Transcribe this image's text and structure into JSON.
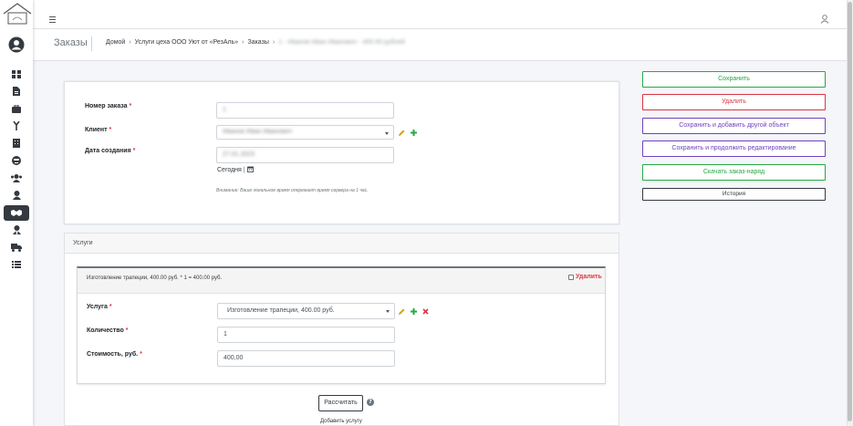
{
  "topbar": {
    "menu_icon": "hamburger-icon",
    "user_icon": "user-icon"
  },
  "sidebar": {
    "logo_icon": "house-logo-icon",
    "avatar_icon": "user-circle-icon",
    "items": [
      {
        "icon": "dashboard-icon"
      },
      {
        "icon": "file-icon"
      },
      {
        "icon": "briefcase-icon"
      },
      {
        "icon": "drill-icon"
      },
      {
        "icon": "building-icon"
      },
      {
        "icon": "face-icon"
      },
      {
        "icon": "users-icon"
      },
      {
        "icon": "user-icon"
      },
      {
        "icon": "handshake-icon",
        "active": true
      },
      {
        "icon": "user-tie-icon"
      },
      {
        "icon": "truck-icon"
      },
      {
        "icon": "list-icon"
      }
    ]
  },
  "header": {
    "title": "Заказы",
    "breadcrumbs": [
      "Домой",
      "Услуги цеха ООО Уют от «РезАль»",
      "Заказы",
      "1 - Иванов Иван Иванович - 400.00 рублей"
    ],
    "breadcrumb_sep": "›"
  },
  "form": {
    "order_number_label": "Номер заказа",
    "order_number_value": "1",
    "client_label": "Клиент",
    "client_value": "Иванов Иван Иванович",
    "created_label": "Дата создания",
    "created_value": "27.01.2023",
    "today_label": "Сегодня",
    "calendar_icon": "calendar-icon",
    "tz_note": "Внимание: Ваше локальное время опережает время сервера на 1 час.",
    "required_mark": "*"
  },
  "services": {
    "section_title": "Услуги",
    "inline_title": "Изготовление трапеции, 400.00 руб. * 1 = 400.00 руб.",
    "delete_label": "Удалить",
    "service_label": "Услуга",
    "service_value": "Изготовление трапеции, 400.00 руб.",
    "quantity_label": "Количество",
    "quantity_value": "1",
    "cost_label": "Стоимость, руб.",
    "cost_value": "400,00",
    "calc_button": "Рассчитать",
    "help_symbol": "?",
    "add_link": "Добавить услугу"
  },
  "actions": {
    "save": "Сохранить",
    "delete": "Удалить",
    "save_add": "Сохранить и добавить другой объект",
    "save_continue": "Сохранить и продолжить редактирование",
    "download": "Скачать заказ-наряд",
    "history": "История"
  },
  "colors": {
    "save": "#28a745",
    "delete": "#dc3545",
    "purple": "#6f42c1",
    "edit_icon": "#d4a514",
    "add_icon": "#28a745",
    "remove_icon": "#dc3545"
  }
}
